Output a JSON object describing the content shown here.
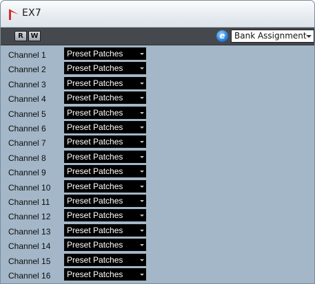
{
  "window": {
    "title": "EX7"
  },
  "toolbar": {
    "r_label": "R",
    "w_label": "W",
    "edit_icon": "e",
    "bank_value": "Bank Assignment"
  },
  "icons": {
    "app": "cubase-logo-icon",
    "edit": "edit-instrument-icon",
    "dropdown": "chevron-down-icon"
  },
  "colors": {
    "panel_bg": "#a3b7c8",
    "toolbar_bg": "#45494e",
    "preset_bg": "#000000",
    "logo_red": "#d62b2b"
  },
  "channels": [
    {
      "label": "Channel 1",
      "value": "Preset Patches"
    },
    {
      "label": "Channel 2",
      "value": "Preset Patches"
    },
    {
      "label": "Channel 3",
      "value": "Preset Patches"
    },
    {
      "label": "Channel 4",
      "value": "Preset Patches"
    },
    {
      "label": "Channel 5",
      "value": "Preset Patches"
    },
    {
      "label": "Channel 6",
      "value": "Preset Patches"
    },
    {
      "label": "Channel 7",
      "value": "Preset Patches"
    },
    {
      "label": "Channel 8",
      "value": "Preset Patches"
    },
    {
      "label": "Channel 9",
      "value": "Preset Patches"
    },
    {
      "label": "Channel 10",
      "value": "Preset Patches"
    },
    {
      "label": "Channel 11",
      "value": "Preset Patches"
    },
    {
      "label": "Channel 12",
      "value": "Preset Patches"
    },
    {
      "label": "Channel 13",
      "value": "Preset Patches"
    },
    {
      "label": "Channel 14",
      "value": "Preset Patches"
    },
    {
      "label": "Channel 15",
      "value": "Preset Patches"
    },
    {
      "label": "Channel 16",
      "value": "Preset Patches"
    }
  ]
}
